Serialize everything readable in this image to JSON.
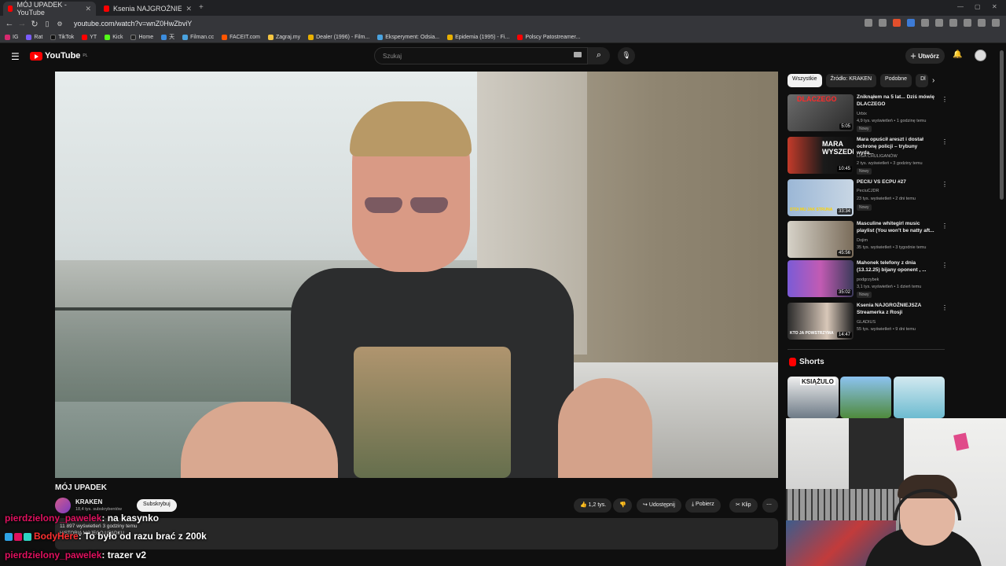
{
  "browser": {
    "tabs": [
      {
        "label": "MÓJ UPADEK - YouTube",
        "active": true
      },
      {
        "label": "Ksenia NAJGROŹNIEJSZA Streamerk..."
      }
    ],
    "url": "youtube.com/watch?v=wnZ0HwZbviY",
    "bookmarks": [
      "IG",
      "Rat",
      "TikTok",
      "YT",
      "Kick",
      "Home",
      "天",
      "Filman.cc",
      "FACEIT.com",
      "Zagraj.my",
      "Dealer (1996) - Film...",
      "Eksperyment: Odsia...",
      "Epidemia (1995) - Fi...",
      "Polscy Patostreamer..."
    ]
  },
  "youtube": {
    "logo": "YouTube",
    "logo_region": "PL",
    "search_placeholder": "Szukaj",
    "create_label": "Utwórz"
  },
  "video": {
    "title": "MÓJ UPADEK",
    "channel": "KRAKEN",
    "subscribers": "18,4 tys. subskrybentów",
    "subscribe_label": "Subskrybuj",
    "likes": "1,2 tys.",
    "share_label": "Udostępnij",
    "download_label": "Pobierz",
    "clip_label": "Klip",
    "views": "11 897 wyświetleń  3 godziny temu",
    "description_start": "HISTORIA MOJEGO UPADKU"
  },
  "sidebar": {
    "chips": [
      "Wszystkie",
      "Źródło: KRAKEN",
      "Podobne",
      "Dl"
    ],
    "recommendations": [
      {
        "title": "Zniknąłem na 5 lat... Dziś mówię DLACZEGO",
        "channel": "Urbix",
        "meta": "4,9 tys. wyświetleń • 1 godzinę temu",
        "badge": "Nowy",
        "duration": "5:05",
        "thumb_text": "DLACZEGO"
      },
      {
        "title": "Mara opuścił areszt i dostał ochronę policji – trybuny wyda...",
        "channel": "LIGA CHULIGANÓW",
        "meta": "2 tys. wyświetleń • 3 godziny temu",
        "badge": "Nowy",
        "duration": "10:45",
        "thumb_text": "MARA WYSZEDŁ"
      },
      {
        "title": "PECIU VS ECPU #27",
        "channel": "PeciuCJDR",
        "meta": "23 tys. wyświetleń • 2 dni temu",
        "badge": "Nowy",
        "duration": "33:34",
        "thumb_text": "STOI MU JAK STRUNA"
      },
      {
        "title": "Masculine whitegirl music playlist (You won't be natty aft...",
        "channel": "Dojim",
        "meta": "35 tys. wyświetleń • 3 tygodnie temu",
        "badge": "",
        "duration": "45:56",
        "thumb_text": ""
      },
      {
        "title": "Mahonek telefony z dnia (13.12.25) bijany oponent , ...",
        "channel": "podgrzybek",
        "meta": "3,1 tys. wyświetleń • 1 dzień temu",
        "badge": "Nowy",
        "duration": "35:02",
        "thumb_text": ""
      },
      {
        "title": "Ksenia NAJGROŹNIEJSZA Streamerka z Rosji",
        "channel": "GLADIUS",
        "meta": "55 tys. wyświetleń • 9 dni temu",
        "badge": "",
        "duration": "14:47",
        "thumb_text": "KTO JA POWSTRZYMA"
      }
    ],
    "shorts_title": "Shorts",
    "shorts": [
      {
        "text": "KSIĄŻULO"
      },
      {
        "text": ""
      },
      {
        "text": ""
      }
    ]
  },
  "chat": [
    {
      "user": "pierdzielony_pawelek",
      "message": ": na kasynko"
    },
    {
      "user": "BodyHere",
      "message": ": To było od razu brać z 200k"
    },
    {
      "user": "pierdzielony_pawelek",
      "message": ": trazer v2"
    }
  ]
}
